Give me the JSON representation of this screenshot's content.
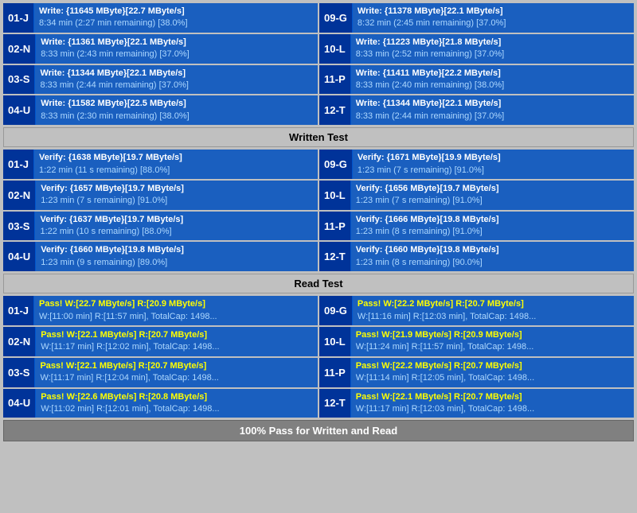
{
  "sections": {
    "write": {
      "cards_left": [
        {
          "id": "01-J",
          "line1": "Write: {11645 MByte}[22.7 MByte/s]",
          "line2": "8:34 min (2:27 min remaining)  [38.0%]"
        },
        {
          "id": "02-N",
          "line1": "Write: {11361 MByte}[22.1 MByte/s]",
          "line2": "8:33 min (2:43 min remaining)  [37.0%]"
        },
        {
          "id": "03-S",
          "line1": "Write: {11344 MByte}[22.1 MByte/s]",
          "line2": "8:33 min (2:44 min remaining)  [37.0%]"
        },
        {
          "id": "04-U",
          "line1": "Write: {11582 MByte}[22.5 MByte/s]",
          "line2": "8:33 min (2:30 min remaining)  [38.0%]"
        }
      ],
      "cards_right": [
        {
          "id": "09-G",
          "line1": "Write: {11378 MByte}[22.1 MByte/s]",
          "line2": "8:32 min (2:45 min remaining)  [37.0%]"
        },
        {
          "id": "10-L",
          "line1": "Write: {11223 MByte}[21.8 MByte/s]",
          "line2": "8:33 min (2:52 min remaining)  [37.0%]"
        },
        {
          "id": "11-P",
          "line1": "Write: {11411 MByte}[22.2 MByte/s]",
          "line2": "8:33 min (2:40 min remaining)  [38.0%]"
        },
        {
          "id": "12-T",
          "line1": "Write: {11344 MByte}[22.1 MByte/s]",
          "line2": "8:33 min (2:44 min remaining)  [37.0%]"
        }
      ],
      "title": "Written Test"
    },
    "verify": {
      "cards_left": [
        {
          "id": "01-J",
          "line1": "Verify: {1638 MByte}[19.7 MByte/s]",
          "line2": "1:22 min (11 s remaining)   [88.0%]"
        },
        {
          "id": "02-N",
          "line1": "Verify: {1657 MByte}[19.7 MByte/s]",
          "line2": "1:23 min (7 s remaining)   [91.0%]"
        },
        {
          "id": "03-S",
          "line1": "Verify: {1637 MByte}[19.7 MByte/s]",
          "line2": "1:22 min (10 s remaining)   [88.0%]"
        },
        {
          "id": "04-U",
          "line1": "Verify: {1660 MByte}[19.8 MByte/s]",
          "line2": "1:23 min (9 s remaining)   [89.0%]"
        }
      ],
      "cards_right": [
        {
          "id": "09-G",
          "line1": "Verify: {1671 MByte}[19.9 MByte/s]",
          "line2": "1:23 min (7 s remaining)   [91.0%]"
        },
        {
          "id": "10-L",
          "line1": "Verify: {1656 MByte}[19.7 MByte/s]",
          "line2": "1:23 min (7 s remaining)   [91.0%]"
        },
        {
          "id": "11-P",
          "line1": "Verify: {1666 MByte}[19.8 MByte/s]",
          "line2": "1:23 min (8 s remaining)   [91.0%]"
        },
        {
          "id": "12-T",
          "line1": "Verify: {1660 MByte}[19.8 MByte/s]",
          "line2": "1:23 min (8 s remaining)   [90.0%]"
        }
      ],
      "title": "Read Test"
    },
    "pass": {
      "cards_left": [
        {
          "id": "01-J",
          "line1": "Pass! W:[22.7 MByte/s] R:[20.9 MByte/s]",
          "line2": "W:[11:00 min] R:[11:57 min], TotalCap: 1498..."
        },
        {
          "id": "02-N",
          "line1": "Pass! W:[22.1 MByte/s] R:[20.7 MByte/s]",
          "line2": "W:[11:17 min] R:[12:02 min], TotalCap: 1498..."
        },
        {
          "id": "03-S",
          "line1": "Pass! W:[22.1 MByte/s] R:[20.7 MByte/s]",
          "line2": "W:[11:17 min] R:[12:04 min], TotalCap: 1498..."
        },
        {
          "id": "04-U",
          "line1": "Pass! W:[22.6 MByte/s] R:[20.8 MByte/s]",
          "line2": "W:[11:02 min] R:[12:01 min], TotalCap: 1498..."
        }
      ],
      "cards_right": [
        {
          "id": "09-G",
          "line1": "Pass! W:[22.2 MByte/s] R:[20.7 MByte/s]",
          "line2": "W:[11:16 min] R:[12:03 min], TotalCap: 1498..."
        },
        {
          "id": "10-L",
          "line1": "Pass! W:[21.9 MByte/s] R:[20.9 MByte/s]",
          "line2": "W:[11:24 min] R:[11:57 min], TotalCap: 1498..."
        },
        {
          "id": "11-P",
          "line1": "Pass! W:[22.2 MByte/s] R:[20.7 MByte/s]",
          "line2": "W:[11:14 min] R:[12:05 min], TotalCap: 1498..."
        },
        {
          "id": "12-T",
          "line1": "Pass! W:[22.1 MByte/s] R:[20.7 MByte/s]",
          "line2": "W:[11:17 min] R:[12:03 min], TotalCap: 1498..."
        }
      ]
    }
  },
  "labels": {
    "written_test": "Written Test",
    "read_test": "Read Test",
    "footer": "100% Pass for Written and Read"
  }
}
